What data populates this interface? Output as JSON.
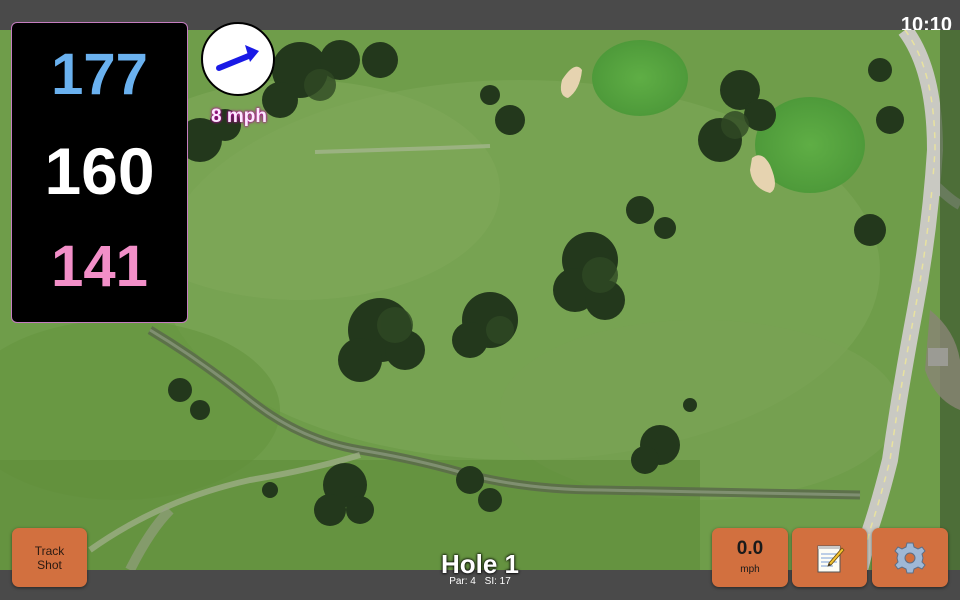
{
  "status_bar": {
    "time": "10:10"
  },
  "distances": {
    "back": "177",
    "middle": "160",
    "front": "141"
  },
  "wind": {
    "speed_label": "8 mph",
    "icon": "wind-direction-arrow-icon"
  },
  "buttons": {
    "track_shot": {
      "line1": "Track",
      "line2": "Shot"
    },
    "speed": {
      "value": "0.0",
      "unit": "mph"
    },
    "notes_icon": "notepad-icon",
    "settings_icon": "gear-icon"
  },
  "hole": {
    "title": "Hole 1",
    "par_label": "Par: 4",
    "si_label": "SI: 17"
  },
  "colors": {
    "back_distance": "#6ab1ef",
    "middle_distance": "#ffffff",
    "front_distance": "#f28fc8",
    "button_accent": "#d2703f",
    "wind_arrow": "#1a1ae6"
  }
}
